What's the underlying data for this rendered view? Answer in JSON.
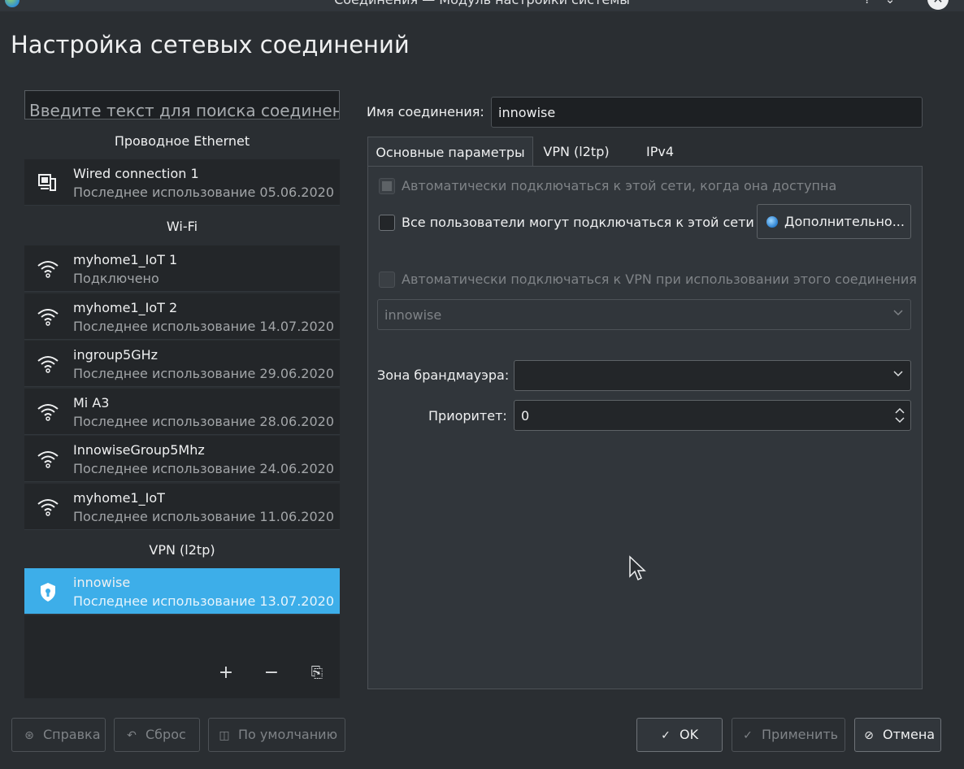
{
  "window": {
    "title": "Соединения — Модуль настройки системы",
    "help_glyph": "?",
    "shade_glyph": "⌄",
    "minimize_glyph": "⌃",
    "close_glyph": "✕"
  },
  "page_title": "Настройка сетевых соединений",
  "search": {
    "placeholder": "Введите текст для поиска соединен"
  },
  "sections": {
    "ethernet": "Проводное Ethernet",
    "wifi": "Wi-Fi",
    "vpn": "VPN (l2tp)"
  },
  "connections": {
    "ethernet": [
      {
        "name": "Wired connection 1",
        "status": "Последнее использование 05.06.2020",
        "icon": "wired-network-icon"
      }
    ],
    "wifi": [
      {
        "name": "myhome1_IoT 1",
        "status": "Подключено",
        "icon": "wifi-icon"
      },
      {
        "name": "myhome1_IoT 2",
        "status": "Последнее использование 14.07.2020",
        "icon": "wifi-icon"
      },
      {
        "name": "ingroup5GHz",
        "status": "Последнее использование 29.06.2020",
        "icon": "wifi-icon"
      },
      {
        "name": "Mi A3",
        "status": "Последнее использование 28.06.2020",
        "icon": "wifi-icon"
      },
      {
        "name": "InnowiseGroup5Mhz",
        "status": "Последнее использование 24.06.2020",
        "icon": "wifi-icon"
      },
      {
        "name": "myhome1_IoT",
        "status": "Последнее использование 11.06.2020",
        "icon": "wifi-icon"
      }
    ],
    "vpn": [
      {
        "name": "innowise",
        "status": "Последнее использование 13.07.2020",
        "icon": "vpn-shield-icon",
        "selected": true
      }
    ]
  },
  "list_footer": {
    "add": "+",
    "remove": "−",
    "export": "⎘"
  },
  "editor": {
    "conn_name_label": "Имя соединения:",
    "conn_name_value": "innowise",
    "tabs": [
      "Основные параметры",
      "VPN (l2tp)",
      "IPv4"
    ],
    "active_tab": 0,
    "auto_connect_label": "Автоматически подключаться к этой сети, когда она доступна",
    "all_users_label": "Все пользователи могут подключаться к этой сети",
    "advanced_button": "Дополнительно...",
    "auto_vpn_label": "Автоматически подключаться к VPN при использовании этого соединения",
    "vpn_combo_value": "innowise",
    "firewall_label": "Зона брандмауэра:",
    "firewall_value": "",
    "priority_label": "Приоритет:",
    "priority_value": "0"
  },
  "buttons": {
    "help": "Справка",
    "reset": "Сброс",
    "defaults": "По умолчанию",
    "ok": "OK",
    "apply": "Применить",
    "cancel": "Отмена"
  },
  "colors": {
    "background": "#2a2e32",
    "selection": "#3daee9",
    "list_bg": "#232629"
  }
}
